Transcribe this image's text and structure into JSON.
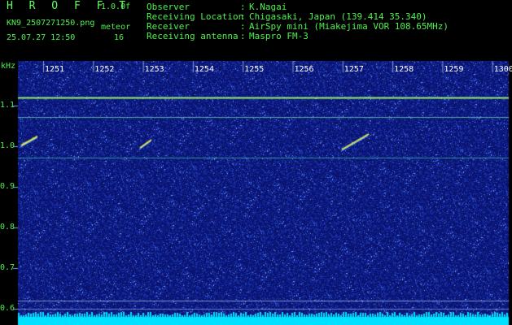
{
  "header": {
    "app_title": "H R O F F T",
    "version": "1.0.0f",
    "filename": "KN9_2507271250.png",
    "timestamp": "25.07.27 12:50",
    "meteor_label": "meteor",
    "meteor_count": "16",
    "info": [
      {
        "key": "Observer",
        "value": "K.Nagai"
      },
      {
        "key": "Receiving Location",
        "value": "Chigasaki, Japan (139.414 35.340)"
      },
      {
        "key": "Receiver",
        "value": "AirSpy mini (Miakejima VOR 108.65MHz)"
      },
      {
        "key": "Receiving antenna",
        "value": "Maspro FM-3"
      }
    ],
    "separator": ":"
  },
  "spectrogram": {
    "y_unit": "kHz",
    "y_ticks": [
      "1.1",
      "1.0",
      "0.9",
      "0.8",
      "0.7",
      "0.6"
    ],
    "x_ticks": [
      "1251",
      "1252",
      "1253",
      "1254",
      "1255",
      "1256",
      "1257",
      "1258",
      "1259",
      "1300"
    ],
    "colors": {
      "background": "#000000",
      "noise_base": "#1a2a7a",
      "grid": "#8aa0d0",
      "carrier": "#9af070",
      "meteor": "#f0e040",
      "bottom_band": "#00e0ff"
    }
  }
}
